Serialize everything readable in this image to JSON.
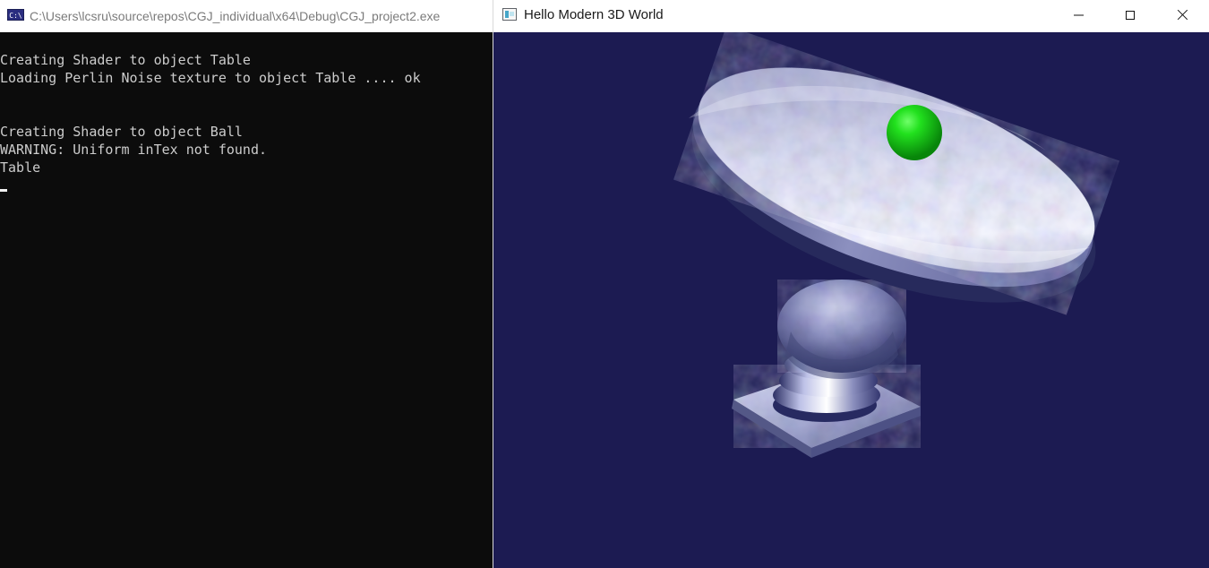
{
  "console": {
    "title": "C:\\Users\\lcsru\\source\\repos\\CGJ_individual\\x64\\Debug\\CGJ_project2.exe",
    "icon": "console-app-icon",
    "lines": [
      "Creating Shader to object Table",
      "Loading Perlin Noise texture to object Table .... ok",
      "",
      "",
      "Creating Shader to object Ball",
      "WARNING: Uniform inTex not found.",
      "Table"
    ],
    "colors": {
      "background": "#0c0c0c",
      "text": "#cccccc",
      "cursor": "#f2f2f2"
    }
  },
  "scene_window": {
    "title": "Hello Modern 3D World",
    "icon": "opengl-window-icon",
    "controls": {
      "minimize_icon": "minimize-icon",
      "maximize_icon": "maximize-icon",
      "close_icon": "close-icon"
    },
    "colors": {
      "background": "#1c1b52",
      "stone": "#b9bdd9",
      "stone_shadow": "#595c93",
      "ball": "#16d614"
    }
  }
}
